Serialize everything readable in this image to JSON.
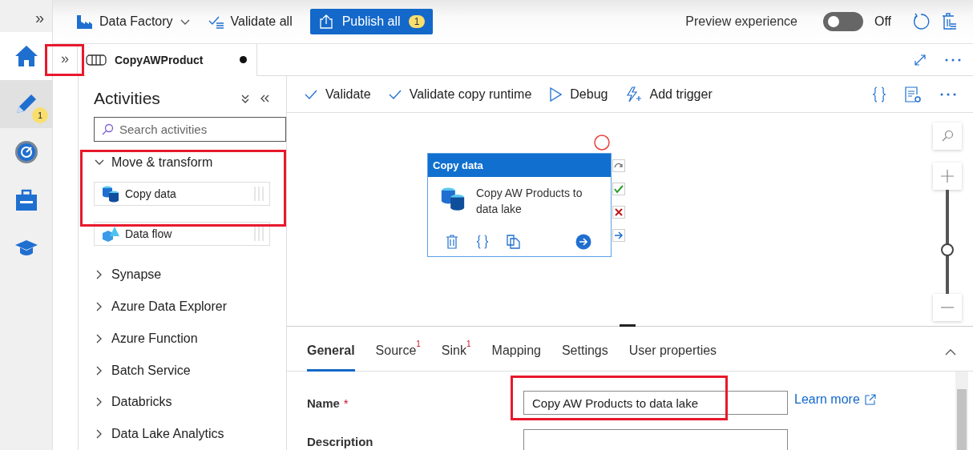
{
  "rail": {
    "expand_glyph": "»",
    "items": [
      {
        "kind": "home",
        "selected": false
      },
      {
        "kind": "author",
        "selected": true,
        "badge": "1"
      },
      {
        "kind": "monitor",
        "selected": false
      },
      {
        "kind": "manage",
        "selected": false
      },
      {
        "kind": "learn",
        "selected": false
      }
    ]
  },
  "top_bar": {
    "factory": "Data Factory",
    "validate_all": "Validate all",
    "publish": {
      "label": "Publish all",
      "badge": "1"
    },
    "preview": {
      "label": "Preview experience",
      "on": false,
      "state": "Off"
    }
  },
  "tab_row": {
    "expand_glyph": "»",
    "tab": {
      "label": "CopyAWProduct",
      "unsaved": true
    }
  },
  "activities": {
    "title": "Activities",
    "search": {
      "placeholder": "Search activities"
    },
    "groups": [
      {
        "label": "Move & transform",
        "expanded": true,
        "children": [
          {
            "label": "Copy data",
            "kind": "copy"
          },
          {
            "label": "Data flow",
            "kind": "dataflow"
          }
        ]
      },
      {
        "label": "Synapse",
        "expanded": false
      },
      {
        "label": "Azure Data Explorer",
        "expanded": false
      },
      {
        "label": "Azure Function",
        "expanded": false
      },
      {
        "label": "Batch Service",
        "expanded": false
      },
      {
        "label": "Databricks",
        "expanded": false
      },
      {
        "label": "Data Lake Analytics",
        "expanded": false
      }
    ]
  },
  "toolbar": [
    {
      "label": "Validate",
      "kind": "check"
    },
    {
      "label": "Validate copy runtime",
      "kind": "check"
    },
    {
      "label": "Debug",
      "kind": "play"
    },
    {
      "label": "Add trigger",
      "kind": "trigger"
    }
  ],
  "canvas": {
    "node": {
      "header": "Copy data",
      "name": "Copy AW Products to data lake",
      "error": true
    },
    "zoom": {
      "level": 0.42
    }
  },
  "properties": {
    "tabs": [
      {
        "label": "General",
        "selected": true
      },
      {
        "label": "Source",
        "selected": false,
        "badge": "1"
      },
      {
        "label": "Sink",
        "selected": false,
        "badge": "1"
      },
      {
        "label": "Mapping",
        "selected": false
      },
      {
        "label": "Settings",
        "selected": false
      },
      {
        "label": "User properties",
        "selected": false
      }
    ],
    "fields": [
      {
        "label": "Name",
        "required_mark": "*",
        "value": "Copy AW Products to data lake",
        "link": "Learn more"
      },
      {
        "label": "Description"
      }
    ]
  }
}
